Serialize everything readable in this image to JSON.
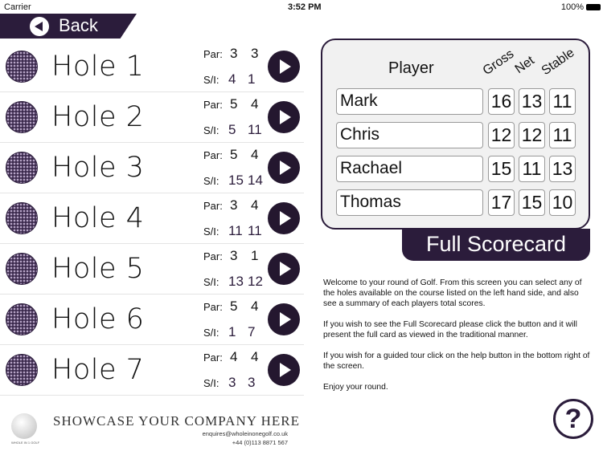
{
  "status": {
    "carrier": "Carrier",
    "time": "3:52 PM",
    "battery": "100%"
  },
  "back_label": "Back",
  "holes": [
    {
      "name": "Hole 1",
      "par": [
        "3",
        "3"
      ],
      "si": [
        "4",
        "1"
      ]
    },
    {
      "name": "Hole 2",
      "par": [
        "5",
        "4"
      ],
      "si": [
        "5",
        "11"
      ]
    },
    {
      "name": "Hole 3",
      "par": [
        "5",
        "4"
      ],
      "si": [
        "15",
        "14"
      ]
    },
    {
      "name": "Hole 4",
      "par": [
        "3",
        "4"
      ],
      "si": [
        "11",
        "11"
      ]
    },
    {
      "name": "Hole 5",
      "par": [
        "3",
        "1"
      ],
      "si": [
        "13",
        "12"
      ]
    },
    {
      "name": "Hole 6",
      "par": [
        "5",
        "4"
      ],
      "si": [
        "1",
        "7"
      ]
    },
    {
      "name": "Hole 7",
      "par": [
        "4",
        "4"
      ],
      "si": [
        "3",
        "3"
      ]
    }
  ],
  "labels": {
    "par": "Par:",
    "si": "S/I:"
  },
  "scores": {
    "headers": {
      "player": "Player",
      "gross": "Gross",
      "net": "Net",
      "stable": "Stable"
    },
    "rows": [
      {
        "player": "Mark",
        "gross": "16",
        "net": "13",
        "stable": "11"
      },
      {
        "player": "Chris",
        "gross": "12",
        "net": "12",
        "stable": "11"
      },
      {
        "player": "Rachael",
        "gross": "15",
        "net": "11",
        "stable": "13"
      },
      {
        "player": "Thomas",
        "gross": "17",
        "net": "15",
        "stable": "10"
      }
    ]
  },
  "full_scorecard": "Full Scorecard",
  "intro": [
    "Welcome to your round of Golf. From this screen you can select any of the holes available on the course listed on the left hand side, and also see a summary of each players total scores.",
    "If you wish to see the Full Scorecard please click the button and it will present the full card as viewed in the traditional manner.",
    "If you wish for a guided tour click on the help button in the bottom right of the screen.",
    "Enjoy your round."
  ],
  "help": "?",
  "ad": {
    "title": "SHOWCASE YOUR COMPANY HERE",
    "email": "enquires@wholeinonegolf.co.uk",
    "phone": "+44 (0)113 8871 567",
    "logo_text": "WHOLE IN 1 GOLF"
  },
  "colors": {
    "accent": "#2b1c3b"
  }
}
